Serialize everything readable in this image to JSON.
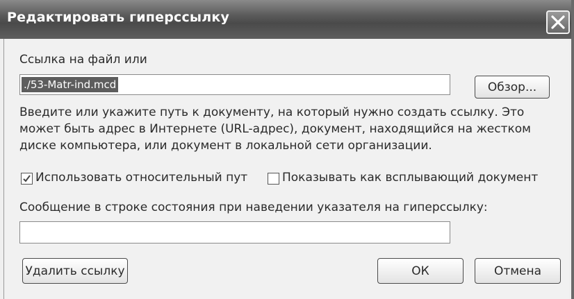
{
  "window": {
    "title": "Редактировать гиперссылку",
    "close_icon": "close-icon"
  },
  "link": {
    "label": "Ссылка на файл или",
    "value": "./53-Matr-ind.mcd",
    "browse_label": "Обзор..."
  },
  "description": "Введите или укажите путь к документу, на который нужно создать ссылку. Это может быть адрес в Интернете (URL-адрес), документ, находящийся на жестком диске компьютера, или документ в локальной сети организации.",
  "options": {
    "relative_path": {
      "label": "Использовать относительный пут",
      "checked": true
    },
    "popup_doc": {
      "label": "Показывать как всплывающий документ",
      "checked": false
    }
  },
  "status_message": {
    "label": "Сообщение в строке состояния при наведении указателя на гиперссылку:",
    "value": ""
  },
  "buttons": {
    "remove_link": "Удалить ссылку",
    "ok": "ОК",
    "cancel": "Отмена"
  }
}
